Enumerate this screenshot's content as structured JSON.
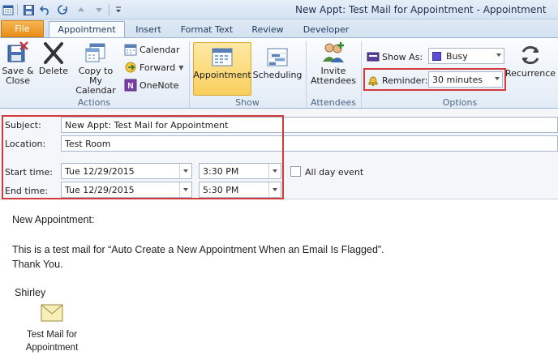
{
  "window": {
    "title": "New Appt: Test Mail for Appointment  -  Appointment"
  },
  "tabs": [
    {
      "label": "File",
      "active": false
    },
    {
      "label": "Appointment",
      "active": true
    },
    {
      "label": "Insert",
      "active": false
    },
    {
      "label": "Format Text",
      "active": false
    },
    {
      "label": "Review",
      "active": false
    },
    {
      "label": "Developer",
      "active": false
    }
  ],
  "ribbon": {
    "actions": {
      "save_close": "Save &\nClose",
      "delete": "Delete",
      "copy_to_calendar": "Copy to My\nCalendar",
      "calendar": "Calendar",
      "forward": "Forward",
      "onenote": "OneNote",
      "group_label": "Actions"
    },
    "show": {
      "appointment": "Appointment",
      "scheduling": "Scheduling",
      "group_label": "Show"
    },
    "attendees": {
      "invite": "Invite\nAttendees",
      "group_label": "Attendees"
    },
    "options": {
      "show_as_label": "Show As:",
      "show_as_value": "Busy",
      "reminder_label": "Reminder:",
      "reminder_value": "30 minutes",
      "recurrence": "Recurrence",
      "group_label": "Options"
    }
  },
  "form": {
    "subject_label": "Subject:",
    "subject_value": "New Appt: Test Mail for Appointment",
    "location_label": "Location:",
    "location_value": "Test Room",
    "start_label": "Start time:",
    "start_date": "Tue 12/29/2015",
    "start_time": "3:30 PM",
    "end_label": "End time:",
    "end_date": "Tue 12/29/2015",
    "end_time": "5:30 PM",
    "all_day_label": "All day event",
    "all_day_checked": false
  },
  "body": {
    "heading": "New Appointment:",
    "line1": "This is a test mail for “Auto Create a New Appointment When an Email Is Flagged”.",
    "line2": "Thank You.",
    "signature": "Shirley",
    "attachment_line1": "Test Mail for",
    "attachment_line2": "Appointment"
  },
  "colors": {
    "highlight_box": "#d23b3b",
    "file_tab": "#e98d17",
    "active_button": "#f8cf5c",
    "busy_swatch": "#5b4fd6"
  }
}
